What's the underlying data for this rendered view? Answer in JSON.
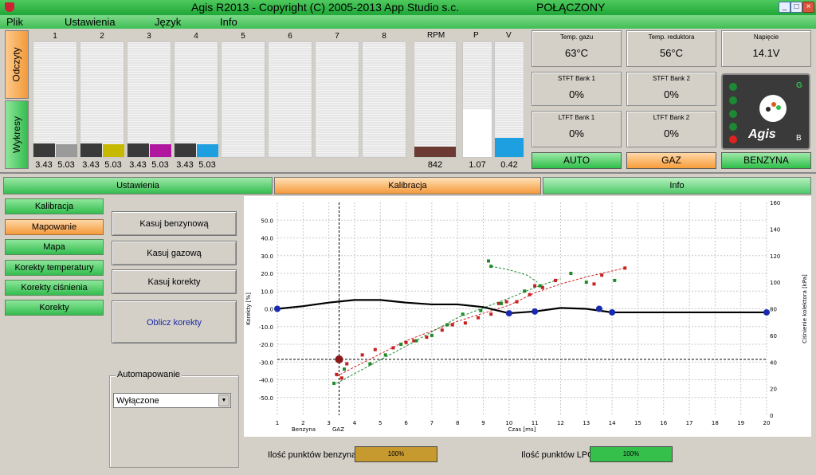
{
  "window": {
    "title": "Agis R2013 - Copyright (C) 2005-2013 App Studio s.c.",
    "status": "POŁĄCZONY",
    "min": "_",
    "max": "□",
    "close": "×"
  },
  "menu": [
    "Plik",
    "Ustawienia",
    "Język",
    "Info"
  ],
  "side_tabs": [
    "Odczyty",
    "Wykresy"
  ],
  "cylinders": {
    "labels": [
      "1",
      "2",
      "3",
      "4",
      "5",
      "6",
      "7",
      "8"
    ],
    "left_vals": [
      "3.43",
      "3.43",
      "3.43",
      "3.43"
    ],
    "right_vals": [
      "5.03",
      "5.03",
      "5.03",
      "5.03"
    ],
    "left_level": 0.12,
    "right_levels": [
      0.11,
      0.11,
      0.11,
      0.11
    ],
    "colors": [
      "#9a9a9a",
      "#c7b800",
      "#b0169e",
      "#1e9fe0"
    ]
  },
  "gauges": {
    "rpm_label": "RPM",
    "rpm": "842",
    "p_label": "P",
    "p": "1.07",
    "p_level": 0.42,
    "v_label": "V",
    "v": "0.42",
    "v_level": 0.17,
    "rpm_level": 0.09
  },
  "panels": {
    "temp_gas_label": "Temp. gazu",
    "temp_gas": "63°C",
    "temp_red_label": "Temp. reduktora",
    "temp_red": "56°C",
    "voltage_label": "Napięcie",
    "voltage": "14.1V",
    "stft1_label": "STFT Bank 1",
    "stft1": "0%",
    "stft2_label": "STFT Bank 2",
    "stft2": "0%",
    "ltft1_label": "LTFT Bank 1",
    "ltft1": "0%",
    "ltft2_label": "LTFT Bank 2",
    "ltft2": "0%"
  },
  "mode_buttons": {
    "auto": "AUTO",
    "gaz": "GAZ",
    "benzyna": "BENZYNA"
  },
  "logo": {
    "g": "G",
    "b": "B",
    "name": "Agis"
  },
  "tabs": [
    "Ustawienia",
    "Kalibracja",
    "Info"
  ],
  "left_tabs": [
    "Kalibracja",
    "Mapowanie",
    "Mapa",
    "Korekty temperatury",
    "Korekty ciśnienia",
    "Korekty"
  ],
  "actions": {
    "kasuj_benz": "Kasuj benzynową",
    "kasuj_gaz": "Kasuj gazową",
    "kasuj_kor": "Kasuj korekty",
    "oblicz": "Oblicz korekty"
  },
  "automap": {
    "label": "Automapowanie",
    "value": "Wyłączone",
    "arrow": "▼"
  },
  "progress": {
    "benz_label": "Ilość punktów benzyna",
    "benz_val": "100%",
    "benz_level": 1,
    "lpg_label": "Ilość punktów LPG",
    "lpg_val": "100%",
    "lpg_level": 1
  },
  "chart_data": {
    "type": "scatter",
    "xlabel": "Czas [ms]",
    "ylabel": "Korekty [%]",
    "y2label": "Ciśnienie kolektora [kPa]",
    "xlim": [
      1,
      20
    ],
    "ylim": [
      -60,
      60
    ],
    "y2lim": [
      0,
      160
    ],
    "xticks": [
      1,
      2,
      3,
      4,
      5,
      6,
      7,
      8,
      9,
      10,
      11,
      12,
      13,
      14,
      15,
      16,
      17,
      18,
      19,
      20
    ],
    "yticks": [
      "50.0",
      "40.0",
      "30.0",
      "20.0",
      "10.0",
      "0.0",
      "-10.0",
      "-20.0",
      "-30.0",
      "-40.0",
      "-50.0"
    ],
    "yticks_values": [
      50,
      40,
      30,
      20,
      10,
      0,
      -10,
      -20,
      -30,
      -40,
      -50
    ],
    "y2ticks": [
      160,
      140,
      120,
      100,
      80,
      60,
      40,
      20,
      0
    ],
    "legend_benz": "Benzyna",
    "legend_gaz": "GAZ",
    "crosshair": {
      "x": 3.4,
      "y": -28.5
    },
    "correction_line": {
      "x": [
        1,
        2,
        3,
        4,
        5,
        6,
        7,
        8,
        9,
        10,
        11,
        12,
        13,
        14,
        15,
        16,
        17,
        18,
        19,
        20
      ],
      "y": [
        0,
        1.5,
        3.5,
        5,
        5,
        3.5,
        2.5,
        2.5,
        1,
        -2.5,
        -1.5,
        0.5,
        0,
        -2,
        -2,
        -2,
        -2,
        -2,
        -2,
        -2
      ]
    },
    "correction_points": {
      "x": [
        1,
        10,
        11,
        13.5,
        14,
        20
      ],
      "y": [
        0,
        -2.5,
        -1.5,
        0,
        -2,
        -2
      ]
    },
    "red_points": {
      "x": [
        3.3,
        3.5,
        3.7,
        4.3,
        4.8,
        5.5,
        6,
        6.3,
        6.8,
        7.4,
        7.8,
        8.3,
        8.8,
        9.3,
        9.6,
        9.9,
        10.3,
        10.8,
        11,
        11.3,
        11.8,
        13.3,
        13.6,
        14.5
      ],
      "y": [
        -37,
        -39,
        -31,
        -26,
        -23,
        -22,
        -19,
        -18,
        -16,
        -12,
        -9,
        -8,
        -5,
        -3,
        3,
        4,
        4,
        8,
        13,
        12,
        16,
        14,
        19,
        23
      ]
    },
    "green_points": {
      "x": [
        3.2,
        3.6,
        4.6,
        5.2,
        5.8,
        6.4,
        7,
        7.6,
        8.2,
        8.9,
        9.2,
        9.3,
        9.7,
        10.6,
        11.2,
        12.4,
        13,
        14.1
      ],
      "y": [
        -42,
        -34,
        -31,
        -26,
        -20,
        -18,
        -15,
        -9,
        -3,
        -1,
        27,
        24,
        3,
        10,
        13,
        20,
        15,
        16
      ]
    },
    "red_trend": {
      "x": [
        3.3,
        6,
        8,
        10,
        11,
        12,
        13,
        14.5
      ],
      "y": [
        -38,
        -18,
        -7,
        2,
        9,
        14,
        18,
        23
      ]
    },
    "green_trend": {
      "x": [
        3.3,
        6,
        8,
        10,
        11,
        12
      ],
      "y": [
        -42,
        -21,
        -5,
        6,
        12,
        17
      ]
    },
    "green_hook": {
      "x": [
        9.3,
        10,
        10.7,
        11.1
      ],
      "y": [
        24,
        22,
        19,
        15
      ]
    }
  }
}
